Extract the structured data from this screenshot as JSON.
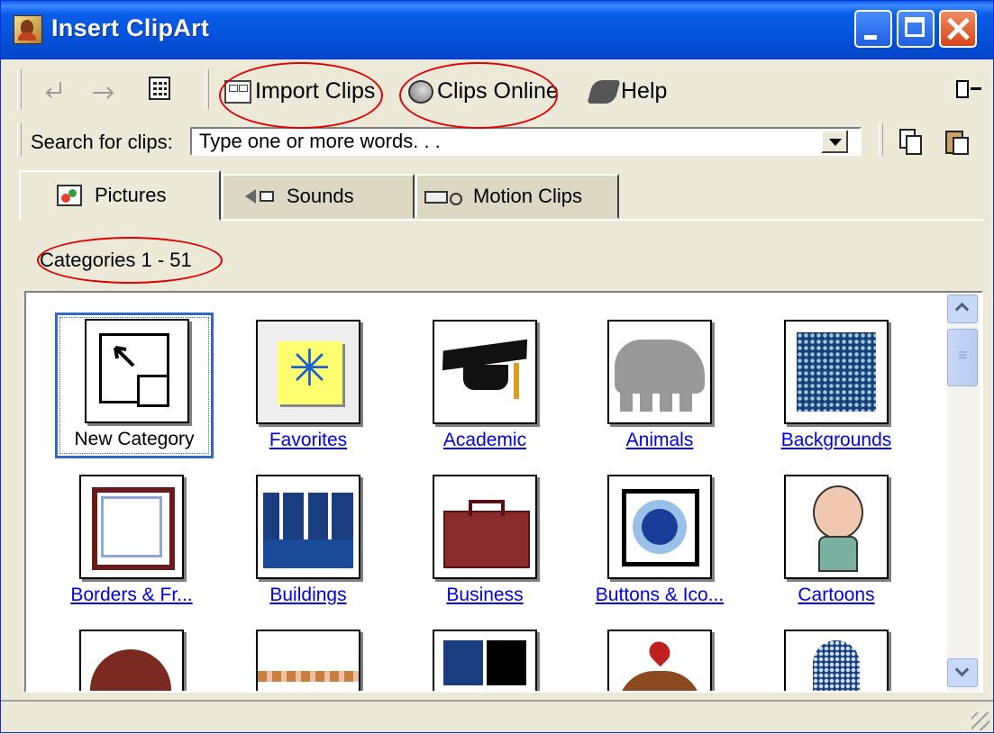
{
  "window": {
    "title": "Insert ClipArt"
  },
  "toolbar": {
    "back_icon": "back-arrow-icon",
    "forward_icon": "forward-arrow-icon",
    "view_icon": "all-categories-icon",
    "import_label": "Import Clips",
    "online_label": "Clips Online",
    "help_label": "Help"
  },
  "search": {
    "label": "Search for clips:",
    "placeholder": "Type one or more words. . ."
  },
  "tabs": [
    {
      "label": "Pictures",
      "icon": "pictures-icon",
      "selected": true
    },
    {
      "label": "Sounds",
      "icon": "sounds-icon",
      "selected": false
    },
    {
      "label": "Motion Clips",
      "icon": "motion-clips-icon",
      "selected": false
    }
  ],
  "categories": {
    "range_text": "Categories 1 - 51",
    "items": [
      {
        "label": "New Category",
        "selected": true
      },
      {
        "label": "Favorites"
      },
      {
        "label": "Academic"
      },
      {
        "label": "Animals"
      },
      {
        "label": "Backgrounds"
      },
      {
        "label": "Borders & Fr..."
      },
      {
        "label": "Buildings"
      },
      {
        "label": "Business"
      },
      {
        "label": "Buttons & Ico..."
      },
      {
        "label": "Cartoons"
      }
    ]
  },
  "colors": {
    "title_bar": "#0553dc",
    "link": "#0000ee",
    "selection": "#316ac5",
    "annotation": "#e00000"
  }
}
